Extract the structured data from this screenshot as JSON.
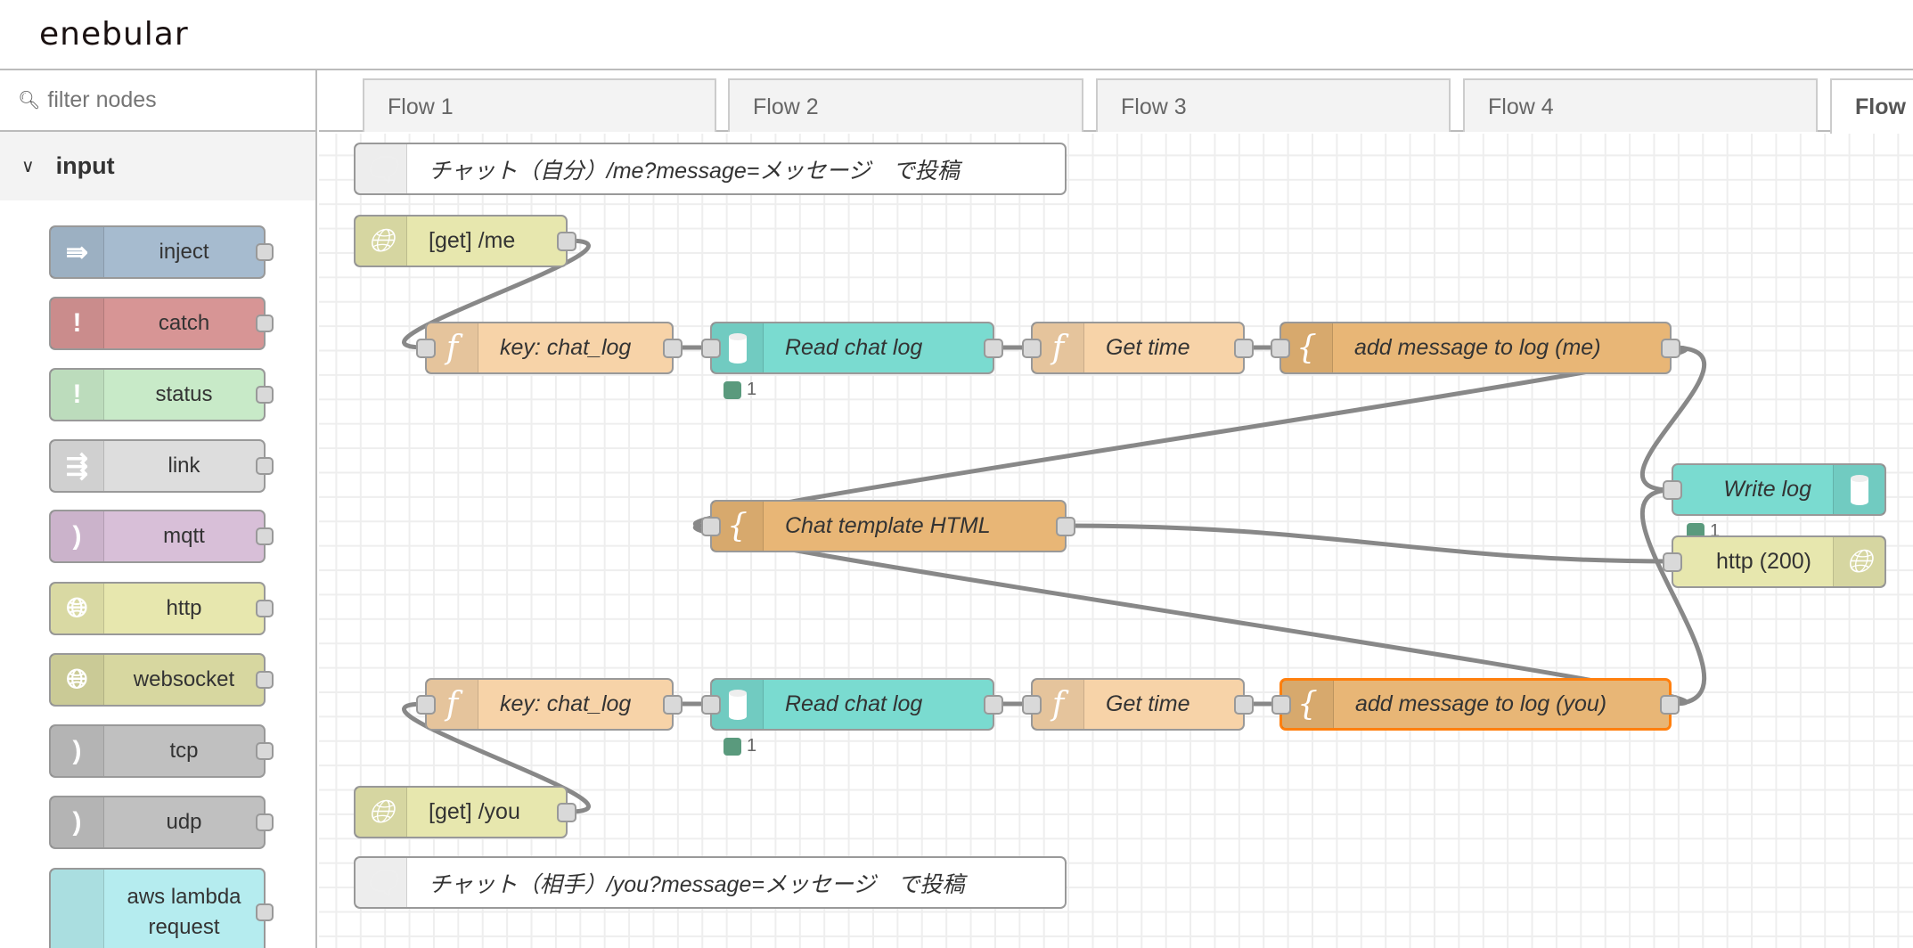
{
  "header": {
    "logo": "enebular"
  },
  "sidebar": {
    "filter_placeholder": "filter nodes",
    "category": "input",
    "nodes": [
      {
        "label": "inject",
        "icon": "arrow-icon",
        "color": "#a6bbcf"
      },
      {
        "label": "catch",
        "icon": "exclamation-icon",
        "color": "#d79595"
      },
      {
        "label": "status",
        "icon": "exclamation-icon",
        "color": "#c8eac8"
      },
      {
        "label": "link",
        "icon": "link-icon",
        "color": "#dddddd"
      },
      {
        "label": "mqtt",
        "icon": "bridge-icon",
        "color": "#d8bfd8"
      },
      {
        "label": "http",
        "icon": "globe-icon",
        "color": "#e7e7ae"
      },
      {
        "label": "websocket",
        "icon": "globe-icon",
        "color": "#d7d7a0"
      },
      {
        "label": "tcp",
        "icon": "bridge-icon",
        "color": "#c0c0c0"
      },
      {
        "label": "udp",
        "icon": "bridge-icon",
        "color": "#c0c0c0"
      },
      {
        "label": "aws lambda request",
        "icon": "lambda-icon",
        "color": "#b5ecef"
      }
    ]
  },
  "tabs": [
    {
      "label": "Flow 1"
    },
    {
      "label": "Flow 2"
    },
    {
      "label": "Flow 3"
    },
    {
      "label": "Flow 4"
    },
    {
      "label": "Flow",
      "active": true
    }
  ],
  "flow": {
    "comment_me": "チャット（自分）/me?message=メッセージ　で投稿",
    "get_me": "[get] /me",
    "key1": "key: chat_log",
    "read1": "Read chat log",
    "time1": "Get time",
    "add_me": "add message to log (me)",
    "read1_status": "1",
    "template": "Chat template HTML",
    "write_log": "Write log",
    "write_status": "1",
    "http_resp": "http (200)",
    "key2": "key: chat_log",
    "read2": "Read chat log",
    "time2": "Get time",
    "add_you": "add message to log (you)",
    "read2_status": "1",
    "get_you": "[get] /you",
    "comment_you": "チャット（相手）/you?message=メッセージ　で投稿"
  }
}
